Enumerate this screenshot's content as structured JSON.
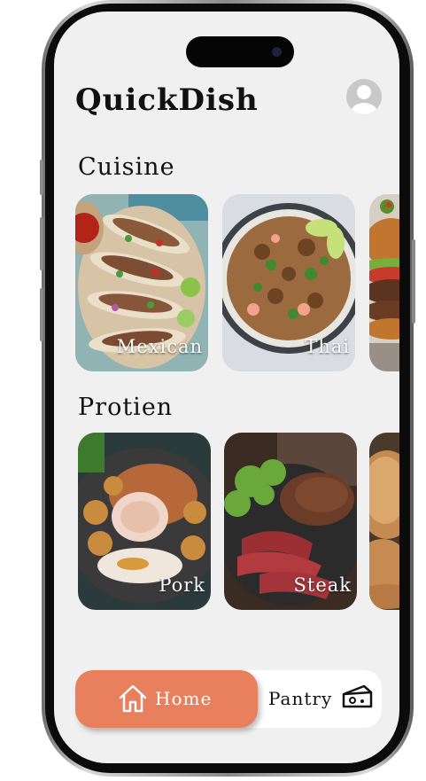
{
  "app": {
    "title": "QuickDish"
  },
  "profile": {
    "icon": "user-avatar-icon"
  },
  "cuisine": {
    "title": "Cuisine",
    "items": [
      {
        "label": "Mexican"
      },
      {
        "label": "Thai"
      },
      {
        "label": ""
      }
    ]
  },
  "protein": {
    "title": "Protien",
    "items": [
      {
        "label": "Pork"
      },
      {
        "label": "Steak"
      },
      {
        "label": ""
      }
    ]
  },
  "nav": {
    "home_label": "Home",
    "pantry_label": "Pantry",
    "home_icon": "home-icon",
    "pantry_icon": "cheese-icon",
    "accent": "#e8805e"
  }
}
